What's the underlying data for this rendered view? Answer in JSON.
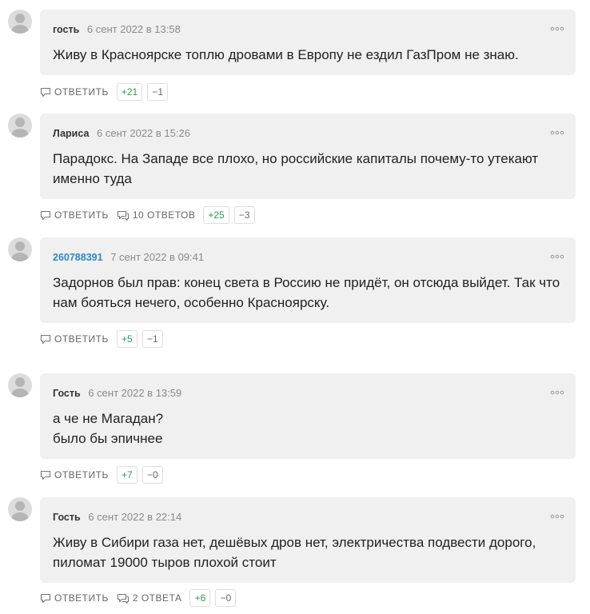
{
  "comments": [
    {
      "author": "гость",
      "date": "6 сент 2022 в 13:58",
      "text": "Живу в Красноярске топлю дровами в Европу не ездил ГазПром не знаю.",
      "reply_label": "ОТВЕТИТЬ",
      "replies_label": "",
      "votes_up": "+21",
      "votes_down": "−1"
    },
    {
      "author": "Лариса",
      "date": "6 сент 2022 в 15:26",
      "text": "Парадокс. На Западе все плохо, но российские капиталы почему-то утекают именно туда",
      "reply_label": "ОТВЕТИТЬ",
      "replies_label": "10 ОТВЕТОВ",
      "votes_up": "+25",
      "votes_down": "−3"
    },
    {
      "author": "260788391",
      "date": "7 сент 2022 в 09:41",
      "text": "Задорнов был прав: конец света в Россию не придёт, он отсюда выйдет. Так что нам бояться нечего, особенно Красноярску.",
      "reply_label": "ОТВЕТИТЬ",
      "replies_label": "",
      "votes_up": "+5",
      "votes_down": "−1"
    },
    {
      "author": "Гость",
      "date": "6 сент 2022 в 13:59",
      "text": "а че не Магадан?\nбыло бы эпичнее",
      "reply_label": "ОТВЕТИТЬ",
      "replies_label": "",
      "votes_up": "+7",
      "votes_down": "−0"
    },
    {
      "author": "Гость",
      "date": "6 сент 2022 в 22:14",
      "text": "Живу в Сибири газа нет, дешёвых дров нет, электричества подвести дорого, пиломат 19000 тыров плохой стоит",
      "reply_label": "ОТВЕТИТЬ",
      "replies_label": "2 ОТВЕТА",
      "votes_up": "+6",
      "votes_down": "−0"
    }
  ],
  "more_icon": "more-dots-icon",
  "reply_icon": "speech-bubble-icon",
  "colors": {
    "bubble_bg": "#f0f0f0",
    "link_author": "#2f87c6",
    "vote_up": "#2e9a4e"
  }
}
